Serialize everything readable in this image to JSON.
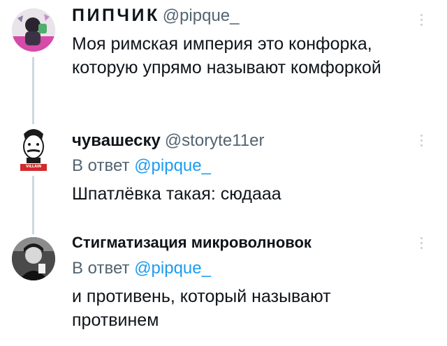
{
  "tweets": [
    {
      "display_name": "ПИПЧИК",
      "handle": "@pipque_",
      "text_lines": [
        "Моя римская империя это конфорка,",
        "которую упрямо называют комфоркой"
      ]
    },
    {
      "display_name": "чувашеску",
      "handle": "@storyte11er",
      "reply_prefix": "В ответ",
      "reply_mention": "@pipque_",
      "text_lines": [
        "Шпатлёвка такая: сюдааа"
      ],
      "avatar_caption": "VILLAIN"
    },
    {
      "display_name": "Стигматизация микроволновок",
      "reply_prefix": "В ответ",
      "reply_mention": "@pipque_",
      "text_lines": [
        "и противень, который называют",
        "протвинем"
      ]
    }
  ],
  "colors": {
    "text": "#0f1419",
    "secondary": "#536471",
    "link": "#1d9bf0",
    "thread_line": "#cfd9de"
  }
}
